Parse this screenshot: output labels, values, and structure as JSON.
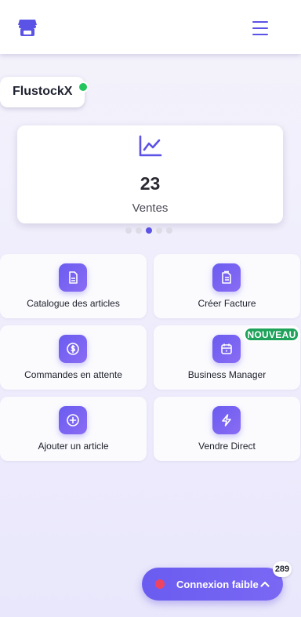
{
  "header": {
    "logo_icon": "storefront-icon",
    "menu_icon": "hamburger-menu-icon",
    "accent_color": "#5b52e6"
  },
  "brand": {
    "name": "FlustockX",
    "status_color": "#22c55e"
  },
  "stat_card": {
    "icon": "line-chart-icon",
    "value": "23",
    "label": "Ventes"
  },
  "carousel": {
    "dots": 5,
    "active_index": 2
  },
  "tiles": [
    {
      "label": "Catalogue des articles",
      "icon": "document-icon"
    },
    {
      "label": "Créer Facture",
      "icon": "invoice-icon"
    },
    {
      "label": "Commandes en attente",
      "icon": "dollar-circle-icon"
    },
    {
      "label": "Business Manager",
      "icon": "briefcase-calendar-icon",
      "badge": "NOUVEAU"
    },
    {
      "label": "Ajouter un article",
      "icon": "plus-circle-icon"
    },
    {
      "label": "Vendre Direct",
      "icon": "lightning-icon"
    }
  ],
  "connection": {
    "label": "Connexion faible",
    "count": "289",
    "status_color": "#ef4461",
    "chevron_icon": "chevron-up-icon"
  }
}
